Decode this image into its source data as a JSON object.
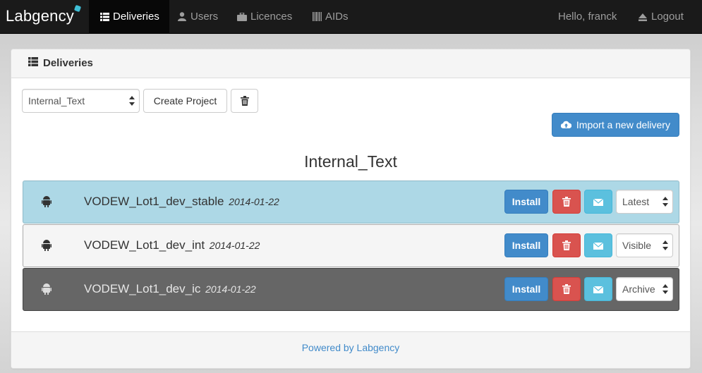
{
  "navbar": {
    "brand": "Labgency",
    "items": [
      {
        "label": "Deliveries",
        "icon": "list-icon",
        "active": true
      },
      {
        "label": "Users",
        "icon": "user-icon",
        "active": false
      },
      {
        "label": "Licences",
        "icon": "briefcase-icon",
        "active": false
      },
      {
        "label": "AIDs",
        "icon": "barcode-icon",
        "active": false
      }
    ],
    "greeting": "Hello, franck",
    "logout": "Logout"
  },
  "panel": {
    "title": "Deliveries",
    "project_select": "Internal_Text",
    "create_project": "Create Project",
    "import_button": "Import a new delivery",
    "project_title": "Internal_Text",
    "footer": "Powered by Labgency"
  },
  "deliveries": [
    {
      "name": "VODEW_Lot1_dev_stable",
      "date": "2014-01-22",
      "platform": "android-icon",
      "install": "Install",
      "status": "Latest",
      "row_color": "#add8e6"
    },
    {
      "name": "VODEW_Lot1_dev_int",
      "date": "2014-01-22",
      "platform": "android-icon",
      "install": "Install",
      "status": "Visible",
      "row_color": "#f5f5f5"
    },
    {
      "name": "VODEW_Lot1_dev_ic",
      "date": "2014-01-22",
      "platform": "android-icon",
      "install": "Install",
      "status": "Archive",
      "row_color": "#666666"
    }
  ],
  "colors": {
    "primary": "#428bca",
    "danger": "#d9534f",
    "info": "#5bc0de",
    "navbar": "#1a1a1a"
  }
}
